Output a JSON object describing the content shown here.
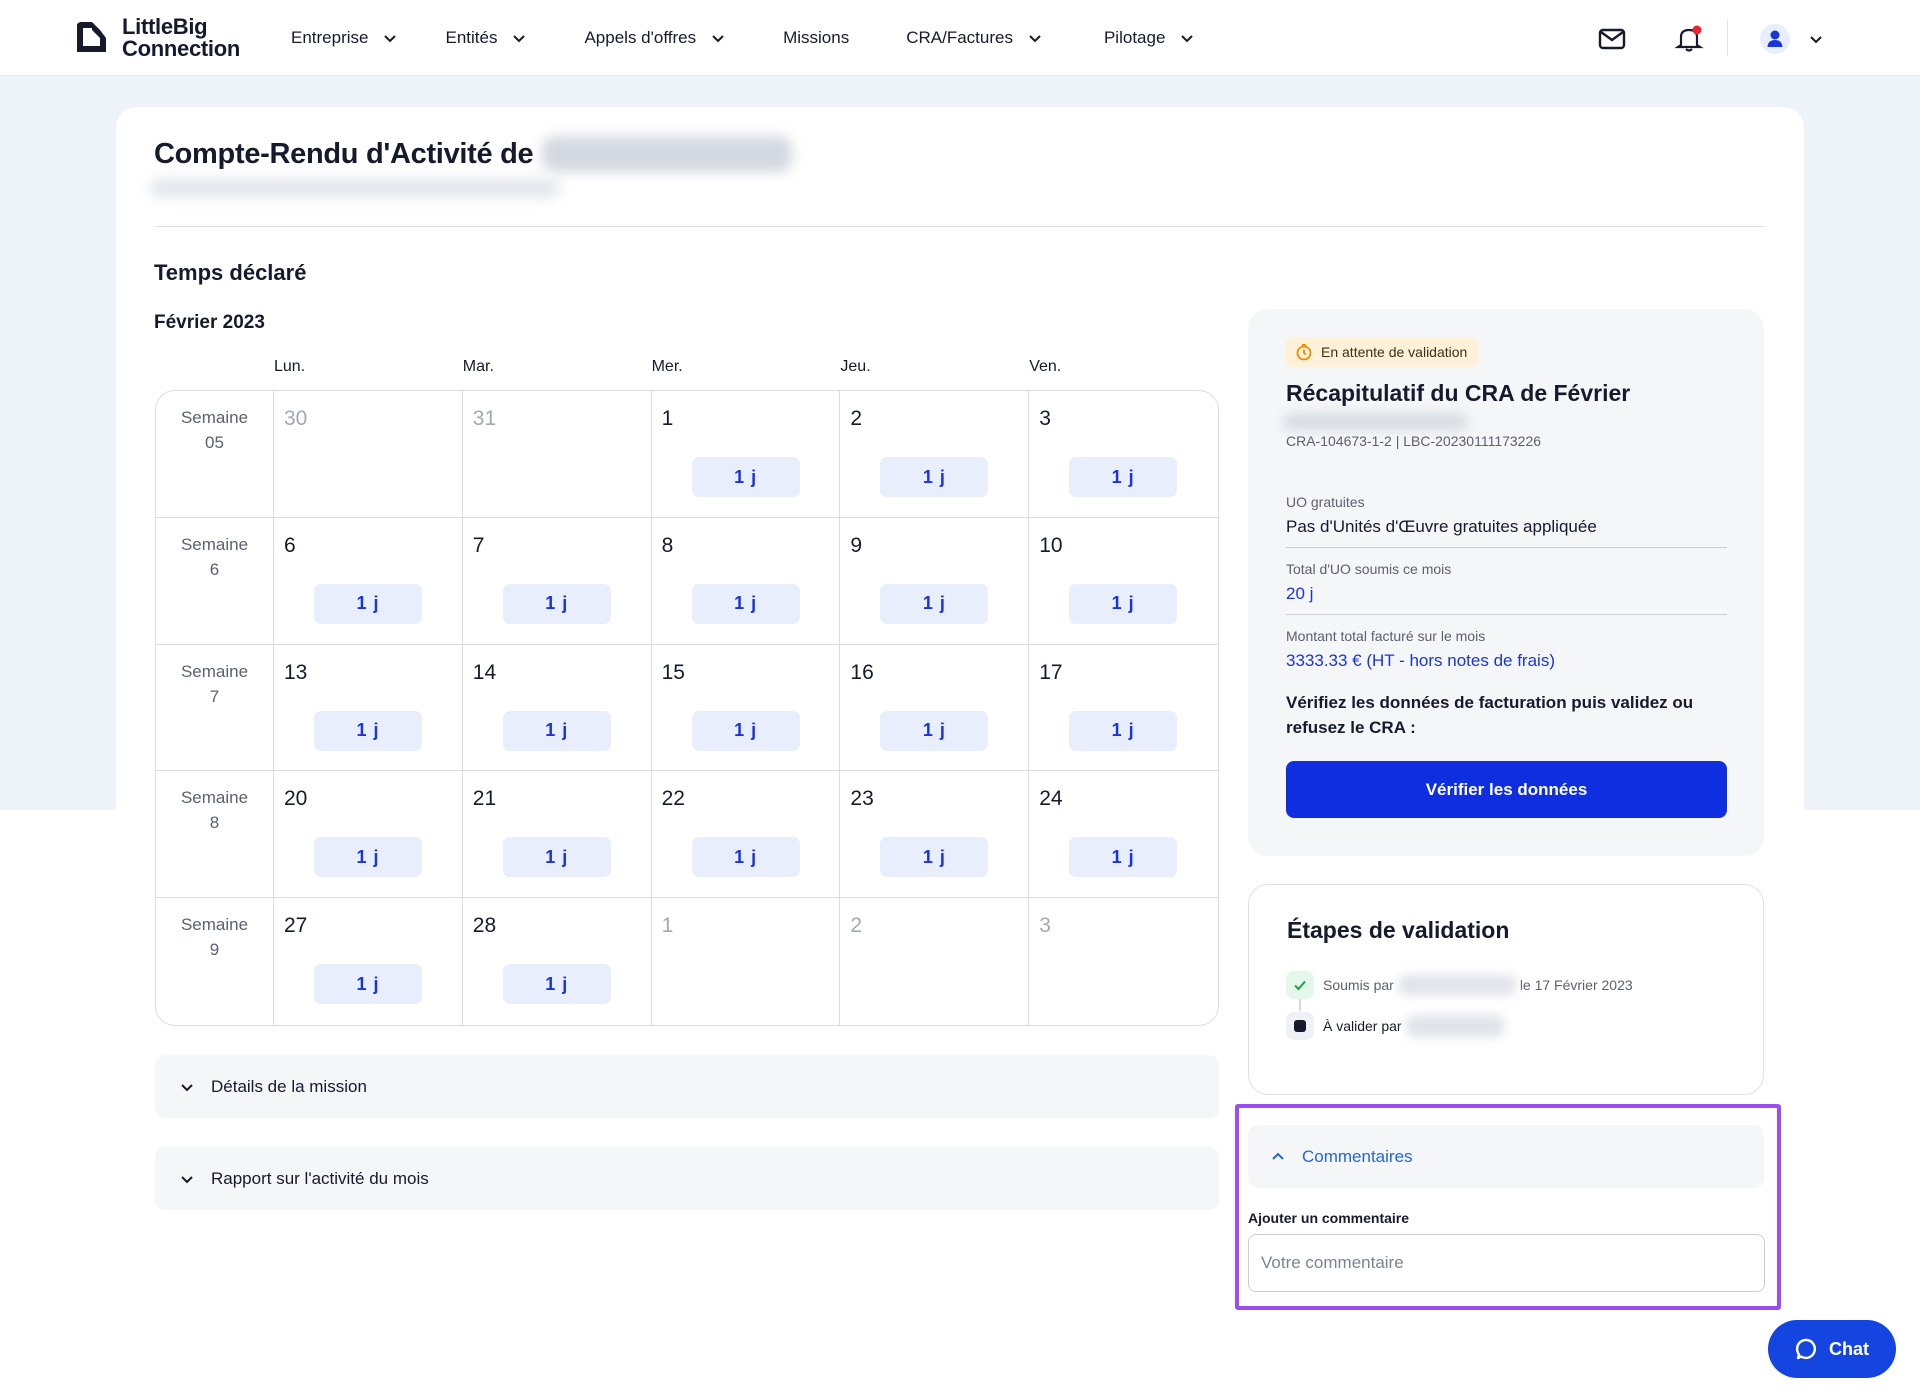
{
  "brand": {
    "line1": "LittleBig",
    "line2": "Connection"
  },
  "nav": {
    "items": [
      {
        "label": "Entreprise",
        "dropdown": true
      },
      {
        "label": "Entités",
        "dropdown": true
      },
      {
        "label": "Appels d'offres",
        "dropdown": true
      },
      {
        "label": "Missions",
        "dropdown": false
      },
      {
        "label": "CRA/Factures",
        "dropdown": true
      },
      {
        "label": "Pilotage",
        "dropdown": true
      }
    ],
    "icons": [
      "mail-icon",
      "bell-icon",
      "user-icon",
      "chevron-down-icon"
    ]
  },
  "page": {
    "title": "Compte-Rendu d'Activité de"
  },
  "timesheet": {
    "section_title": "Temps déclaré",
    "month": "Février 2023",
    "day_headers": [
      "Lun.",
      "Mar.",
      "Mer.",
      "Jeu.",
      "Ven."
    ],
    "weeks": [
      {
        "label_line1": "Semaine",
        "label_line2": "05",
        "days": [
          {
            "num": "30",
            "muted": true,
            "chip": ""
          },
          {
            "num": "31",
            "muted": true,
            "chip": ""
          },
          {
            "num": "1",
            "muted": false,
            "chip": "1 j"
          },
          {
            "num": "2",
            "muted": false,
            "chip": "1 j"
          },
          {
            "num": "3",
            "muted": false,
            "chip": "1 j"
          }
        ]
      },
      {
        "label_line1": "Semaine",
        "label_line2": "6",
        "days": [
          {
            "num": "6",
            "muted": false,
            "chip": "1 j"
          },
          {
            "num": "7",
            "muted": false,
            "chip": "1 j"
          },
          {
            "num": "8",
            "muted": false,
            "chip": "1 j"
          },
          {
            "num": "9",
            "muted": false,
            "chip": "1 j"
          },
          {
            "num": "10",
            "muted": false,
            "chip": "1 j"
          }
        ]
      },
      {
        "label_line1": "Semaine",
        "label_line2": "7",
        "days": [
          {
            "num": "13",
            "muted": false,
            "chip": "1 j"
          },
          {
            "num": "14",
            "muted": false,
            "chip": "1 j"
          },
          {
            "num": "15",
            "muted": false,
            "chip": "1 j"
          },
          {
            "num": "16",
            "muted": false,
            "chip": "1 j"
          },
          {
            "num": "17",
            "muted": false,
            "chip": "1 j"
          }
        ]
      },
      {
        "label_line1": "Semaine",
        "label_line2": "8",
        "days": [
          {
            "num": "20",
            "muted": false,
            "chip": "1 j"
          },
          {
            "num": "21",
            "muted": false,
            "chip": "1 j"
          },
          {
            "num": "22",
            "muted": false,
            "chip": "1 j"
          },
          {
            "num": "23",
            "muted": false,
            "chip": "1 j"
          },
          {
            "num": "24",
            "muted": false,
            "chip": "1 j"
          }
        ]
      },
      {
        "label_line1": "Semaine",
        "label_line2": "9",
        "days": [
          {
            "num": "27",
            "muted": false,
            "chip": "1 j"
          },
          {
            "num": "28",
            "muted": false,
            "chip": "1 j"
          },
          {
            "num": "1",
            "muted": true,
            "chip": ""
          },
          {
            "num": "2",
            "muted": true,
            "chip": ""
          },
          {
            "num": "3",
            "muted": true,
            "chip": ""
          }
        ]
      }
    ]
  },
  "accordions": {
    "mission_details": "Détails de la mission",
    "monthly_report": "Rapport sur l'activité du mois"
  },
  "summary": {
    "status_badge": "En attente de validation",
    "title": "Récapitulatif du CRA de Février",
    "reference": "CRA-104673-1-2 | LBC-20230111173226",
    "free_uo_label": "UO gratuites",
    "free_uo_value": "Pas d'Unités d'Œuvre gratuites appliquée",
    "total_uo_label": "Total d'UO soumis ce mois",
    "total_uo_value": "20 j",
    "amount_label": "Montant total facturé sur le mois",
    "amount_value": "3333.33 € (HT - hors notes de frais)",
    "instruction": "Vérifiez les données de facturation puis validez ou refusez le CRA :",
    "verify_button": "Vérifier les données",
    "badge_color": "#fdf1d9",
    "accent_color": "#0f2ee0"
  },
  "validation": {
    "title": "Étapes de validation",
    "step1_prefix": "Soumis par",
    "step1_suffix": "le 17 Février 2023",
    "step2_prefix": "À valider par"
  },
  "comments": {
    "section_label": "Commentaires",
    "field_label": "Ajouter un commentaire",
    "placeholder": "Votre commentaire"
  },
  "chat": {
    "label": "Chat"
  }
}
